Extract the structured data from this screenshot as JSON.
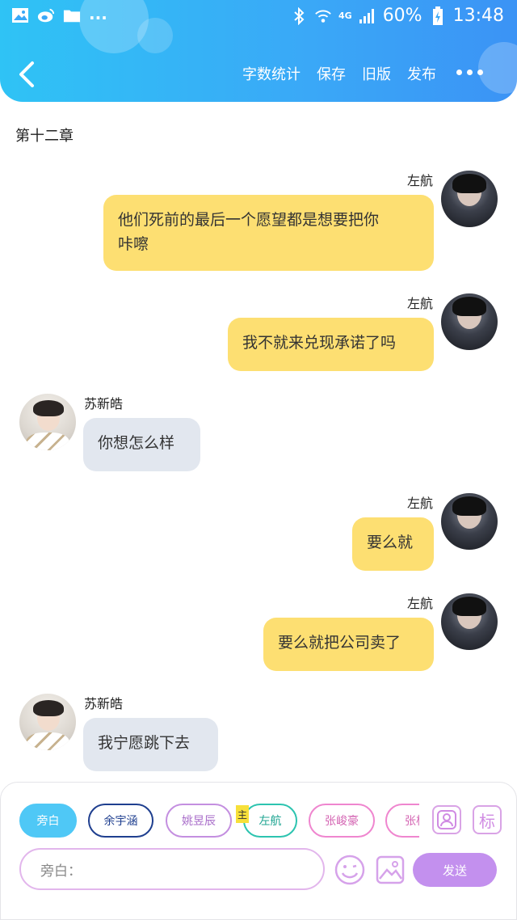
{
  "status_bar": {
    "battery": "60%",
    "time": "13:48",
    "network": "4G",
    "icons": [
      "image-icon",
      "weibo-icon",
      "folder-icon",
      "more-dots-icon",
      "bluetooth-icon",
      "wifi-icon",
      "signal-icon",
      "battery-charging-icon"
    ],
    "more": "..."
  },
  "header": {
    "back_icon": "chevron-left-icon",
    "actions": [
      {
        "label": "字数统计"
      },
      {
        "label": "保存"
      },
      {
        "label": "旧版"
      },
      {
        "label": "发布"
      }
    ],
    "more_icon": "more-horizontal-icon",
    "accent": "#3aa8f7"
  },
  "chapter_title": "第十二章",
  "messages": [
    {
      "side": "right",
      "sender": "左航",
      "text_lines": [
        "他们死前的最后一个愿望都是想要把你",
        "咔嚓"
      ]
    },
    {
      "side": "right",
      "sender": "左航",
      "text_lines": [
        "我不就来兑现承诺了吗"
      ]
    },
    {
      "side": "left",
      "sender": "苏新皓",
      "text_lines": [
        "你想怎么样"
      ]
    },
    {
      "side": "right",
      "sender": "左航",
      "text_lines": [
        "要么就"
      ]
    },
    {
      "side": "right",
      "sender": "左航",
      "text_lines": [
        "要么就把公司卖了"
      ]
    },
    {
      "side": "left",
      "sender": "苏新皓",
      "text_lines": [
        "我宁愿跳下去"
      ]
    }
  ],
  "bubble_colors": {
    "right": "#fddf72",
    "left": "#e2e7ef"
  },
  "composer": {
    "characters": [
      {
        "label": "旁白",
        "active": true,
        "color": "#4fc8f6"
      },
      {
        "label": "余宇涵",
        "active": false,
        "color": "#1f3f8f"
      },
      {
        "label": "姚昱辰",
        "active": false,
        "color": "#c48fe0"
      },
      {
        "label": "左航",
        "active": false,
        "color": "#2dc4b0"
      },
      {
        "label": "张峻豪",
        "active": false,
        "color": "#ef86cf"
      },
      {
        "label": "张极",
        "active": false,
        "color": "#ef86cf"
      }
    ],
    "main_tag": "主",
    "contact_icon": "contact-card-icon",
    "mark_label": "标",
    "input_placeholder": "旁白：",
    "emoji_icon": "emoji-icon",
    "image_icon": "image-icon",
    "send_label": "发送",
    "send_color": "#c390ee"
  }
}
